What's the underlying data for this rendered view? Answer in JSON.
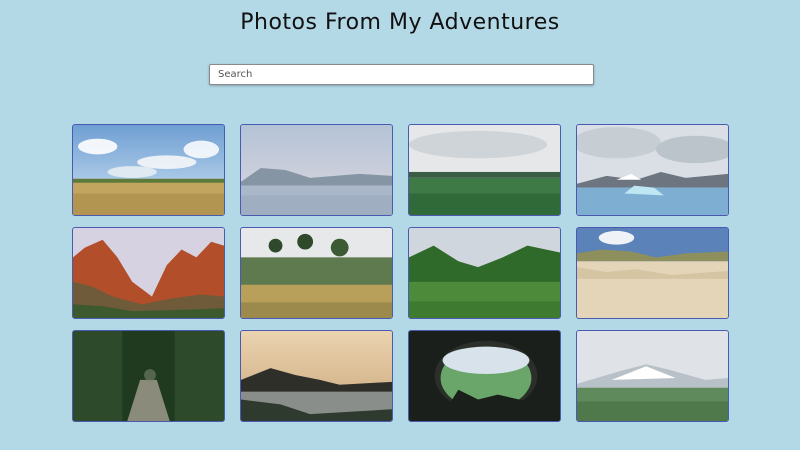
{
  "page": {
    "title": "Photos From My Adventures"
  },
  "search": {
    "placeholder": "Search",
    "value": ""
  },
  "gallery": {
    "photos": [
      {
        "subject": "grassy field under blue sky with clouds"
      },
      {
        "subject": "calm lake with misty mountains"
      },
      {
        "subject": "green plain under overcast sky"
      },
      {
        "subject": "iceberg lagoon with snowy mountains"
      },
      {
        "subject": "red rock canyon cliffs"
      },
      {
        "subject": "moorland with twisted trees"
      },
      {
        "subject": "green valley hills"
      },
      {
        "subject": "sand dunes with grass"
      },
      {
        "subject": "forest path with trees"
      },
      {
        "subject": "coastline at sunset"
      },
      {
        "subject": "view through a cave opening"
      },
      {
        "subject": "snowy mountain over heath"
      }
    ]
  },
  "colors": {
    "background": "#b3d8e6",
    "thumbnail_border": "#4a5ab0"
  }
}
